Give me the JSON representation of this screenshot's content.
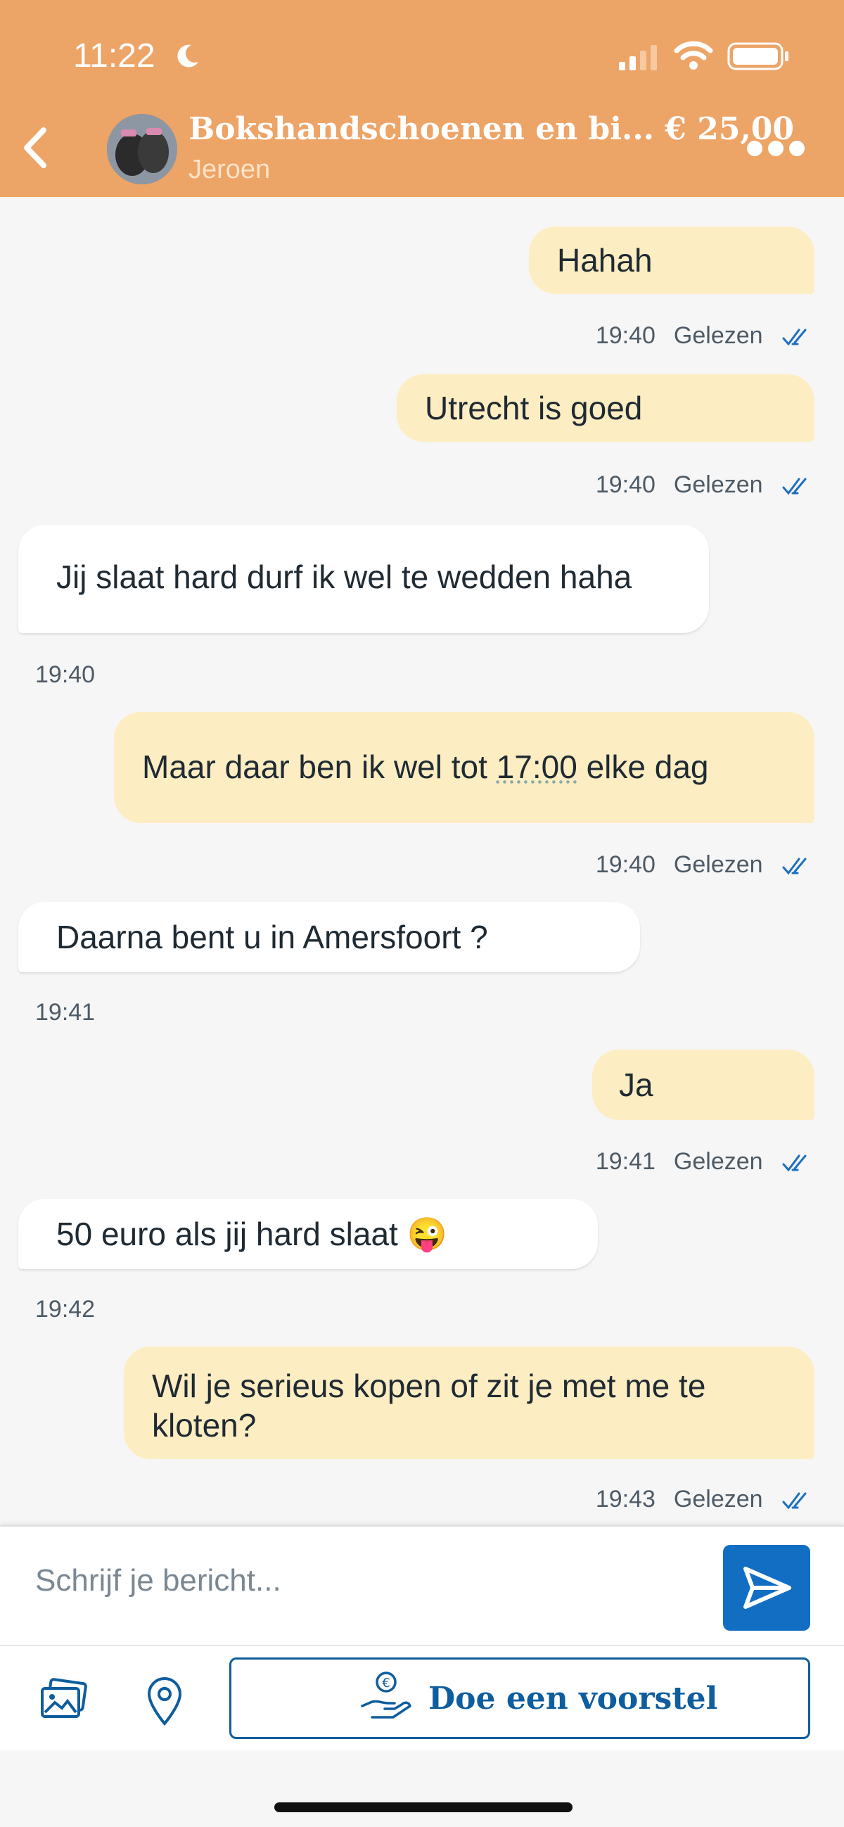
{
  "status": {
    "time": "11:22"
  },
  "header": {
    "title": "Bokshandschoenen en bi... € 25,00",
    "seller": "Jeroen"
  },
  "messages": [
    {
      "dir": "out",
      "text": "Hahah",
      "time": "19:40",
      "status": "Gelezen"
    },
    {
      "dir": "out",
      "text": "Utrecht is goed",
      "time": "19:40",
      "status": "Gelezen"
    },
    {
      "dir": "in",
      "text": "Jij slaat hard durf ik wel te wedden haha",
      "time": "19:40"
    },
    {
      "dir": "out",
      "text_before": "Maar daar ben ik wel tot ",
      "text_link": "17:00",
      "text_after": " elke dag",
      "time": "19:40",
      "status": "Gelezen"
    },
    {
      "dir": "in",
      "text": "Daarna bent u in Amersfoort ?",
      "time": "19:41"
    },
    {
      "dir": "out",
      "text": "Ja",
      "time": "19:41",
      "status": "Gelezen"
    },
    {
      "dir": "in",
      "text": "50 euro als jij hard slaat",
      "emoji": "😜",
      "time": "19:42"
    },
    {
      "dir": "out",
      "text": "Wil je serieus kopen of zit je met me te kloten?",
      "time": "19:43",
      "status": "Gelezen"
    }
  ],
  "composer": {
    "placeholder": "Schrijf je bericht..."
  },
  "actions": {
    "offer_label": "Doe een voorstel"
  },
  "colors": {
    "header": "#eda467",
    "outgoing": "#fdedc2",
    "accent": "#126ec2"
  }
}
